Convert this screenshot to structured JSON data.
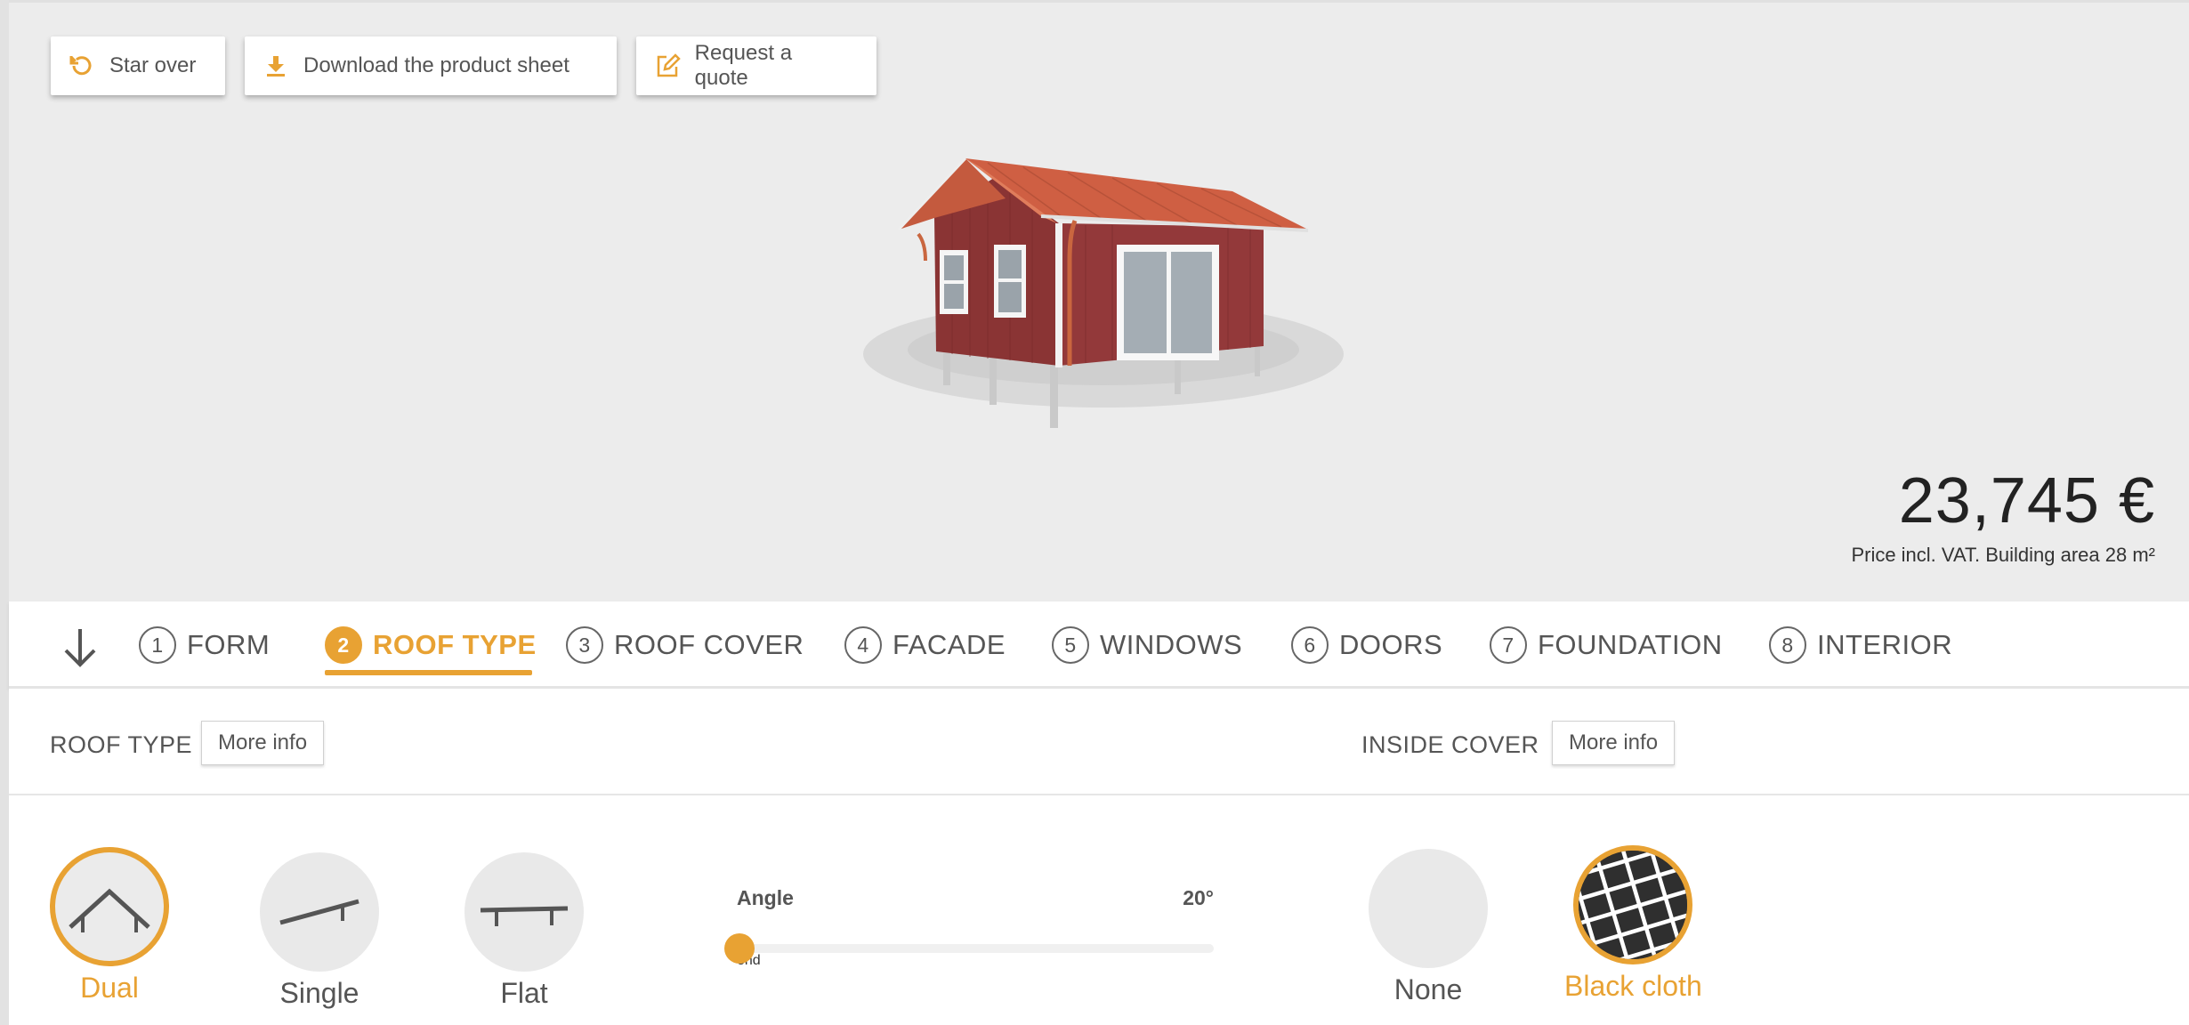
{
  "toolbar": {
    "start_over": "Star over",
    "download": "Download the product sheet",
    "quote": "Request a quote"
  },
  "price": {
    "value": "23,745 €",
    "note": "Price incl. VAT. Building area 28 m²"
  },
  "steps": [
    {
      "num": "1",
      "label": "FORM"
    },
    {
      "num": "2",
      "label": "ROOF TYPE",
      "active": true
    },
    {
      "num": "3",
      "label": "ROOF COVER"
    },
    {
      "num": "4",
      "label": "FACADE"
    },
    {
      "num": "5",
      "label": "WINDOWS"
    },
    {
      "num": "6",
      "label": "DOORS"
    },
    {
      "num": "7",
      "label": "FOUNDATION"
    },
    {
      "num": "8",
      "label": "INTERIOR"
    }
  ],
  "roof_type": {
    "label": "ROOF TYPE",
    "more_info": "More info",
    "options": [
      {
        "label": "Dual",
        "icon": "dual-roof-icon",
        "selected": true
      },
      {
        "label": "Single",
        "icon": "single-roof-icon",
        "selected": false
      },
      {
        "label": "Flat",
        "icon": "flat-roof-icon",
        "selected": false
      }
    ],
    "angle_label": "Angle",
    "angle_value": "20°"
  },
  "inside_cover": {
    "label": "INSIDE COVER",
    "more_info": "More info",
    "options": [
      {
        "label": "None",
        "selected": false
      },
      {
        "label": "Black cloth",
        "icon": "black-cloth-icon",
        "selected": true
      }
    ]
  },
  "colors": {
    "accent": "#e8a233",
    "viewer_bg": "#ececec"
  }
}
